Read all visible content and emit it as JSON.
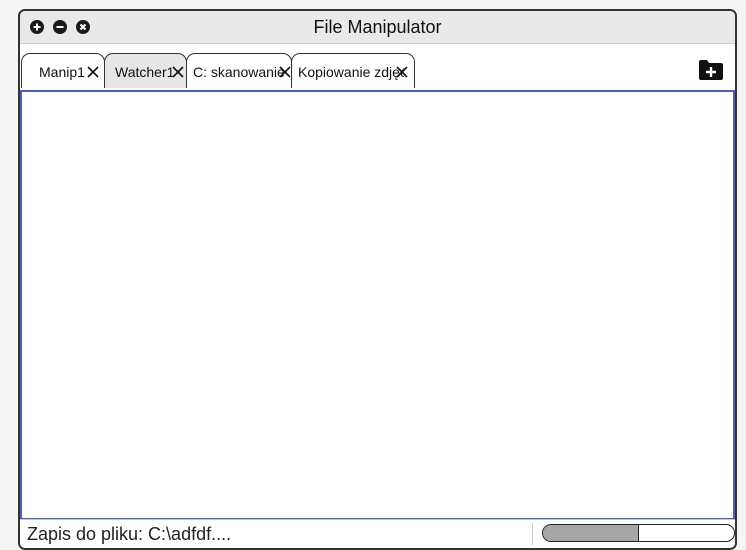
{
  "window": {
    "title": "File Manipulator",
    "controls": [
      {
        "name": "maximize",
        "icon": "plus-circle-icon"
      },
      {
        "name": "minimize",
        "icon": "minus-circle-icon"
      },
      {
        "name": "close",
        "icon": "close-circle-icon"
      }
    ]
  },
  "tabs": [
    {
      "label": "Manip1",
      "active": false,
      "close_icon": "close-icon"
    },
    {
      "label": "Watcher1",
      "active": true,
      "close_icon": "close-icon"
    },
    {
      "label": "C: skanowanie",
      "active": false,
      "close_icon": "close-icon"
    },
    {
      "label": "Kopiowanie zdjęć",
      "active": false,
      "close_icon": "close-icon"
    }
  ],
  "new_tab_icon": "folder-plus-icon",
  "status": {
    "text": "Zapis do pliku: C:\\adfdf....",
    "progress": 0.5
  },
  "colors": {
    "content_border": "#4a5fc1",
    "active_tab": "#e6e6e6",
    "progress_fill": "#a6a6a6"
  }
}
